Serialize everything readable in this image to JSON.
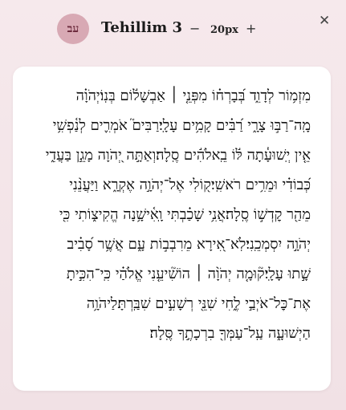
{
  "header": {
    "lang_badge": "עב",
    "title": "Tehillim 3",
    "decrease_label": "−",
    "font_size": "20px",
    "increase_label": "+",
    "close_label": "✕"
  },
  "text": {
    "lines": [
      "מִזְמ֥וֹר לְדָוִ֑ד בְּ֝בָרְח֗וֹ מִפְּנֵ֤י ׀ אַבְשָׁל֬וֹם בְּנֽוֹ׃יְהֹוָ֗ה",
      "מָֽה־רַבּ֣וּ צָרָ֑י רַ֝בִּ֗ים קָמִ֥ים עָלָֽי׃רַבִּים֮ אֹמְרִ֪ים לְנַ֫פְשִׁ֥י",
      "אֵ֤ין יְֽשׁוּעָ֓תָה לּ֬וֹ בֵֽאלֹהִ֬ים סֶֽלָה׃וְאַתָּ֣ה יְ֭הֹוָה מָגֵ֣ן בַּעֲדִ֑י",
      "כְּ֝בוֹדִ֗י וּמֵרִ֥ים רֹאשִֽׁי׃ק֭וֹלִי אֶל־יְהֹוָ֣ה אֶקְרָ֑א וַיַּעֲנֵ֨נִי",
      "מֵהַ֖ר קׇדְשׁ֣וֹ סֶֽלָה׃אֲנִ֥י שָׁכַ֗בְתִּי וָֽאִ֫ישָׁ֥נָה הֱקִיצ֑וֹתִי כִּ֖י",
      "יְהֹוָ֣ה יִסְמְכֵֽנִי׃לֹֽא־אִ֭ירָא מֵרִבְב֣וֹת עָ֑ם אֲשֶׁ֥ר סָ֝בִ֗יב",
      "שָׁ֣תוּ עָלָֽי׃ק֘וּמָ֤ה יְהֹוָ֨ה ׀ הוֹשִׁ֘יעֵ֤נִי אֱלֹהַ֗י כִּֽי־הִכִּ֣יתָ",
      "אֶת־כׇּל־אֹיְבַ֣י לֶ֑חִי שִׁנֵּ֖י רְשָׁעִ֣ים שִׁבַּֽרְתָּ׃לַיהֹוָ֥ה",
      "הַיְשׁוּעָ֑ה עַֽל־עַמְּךָ֖ בִרְכָתֶ֣ךָ סֶּֽלָה׃"
    ]
  }
}
